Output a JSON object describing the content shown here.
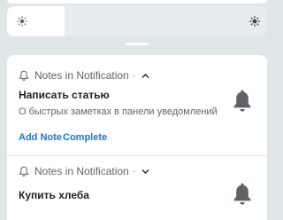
{
  "quick_settings": {
    "brightness_level": 0.22,
    "icons": [
      "brightness-low-icon",
      "brightness-high-icon"
    ]
  },
  "notifications": [
    {
      "app_name": "Notes in Notification",
      "expanded": true,
      "title": "Написать статью",
      "body": "О быстрых заметках в панели уведомлений",
      "actions": [
        "Add Note",
        "Complete"
      ]
    },
    {
      "app_name": "Notes in Notification",
      "expanded": false,
      "title": "Купить хлеба"
    }
  ],
  "separator_dot": "·",
  "colors": {
    "background": "#dfe6e8",
    "card": "#ffffff",
    "slider_track": "#e8ecee",
    "accent": "#1a73e8",
    "secondary_text": "#5f6368",
    "bell_icon": "#5f6368"
  }
}
